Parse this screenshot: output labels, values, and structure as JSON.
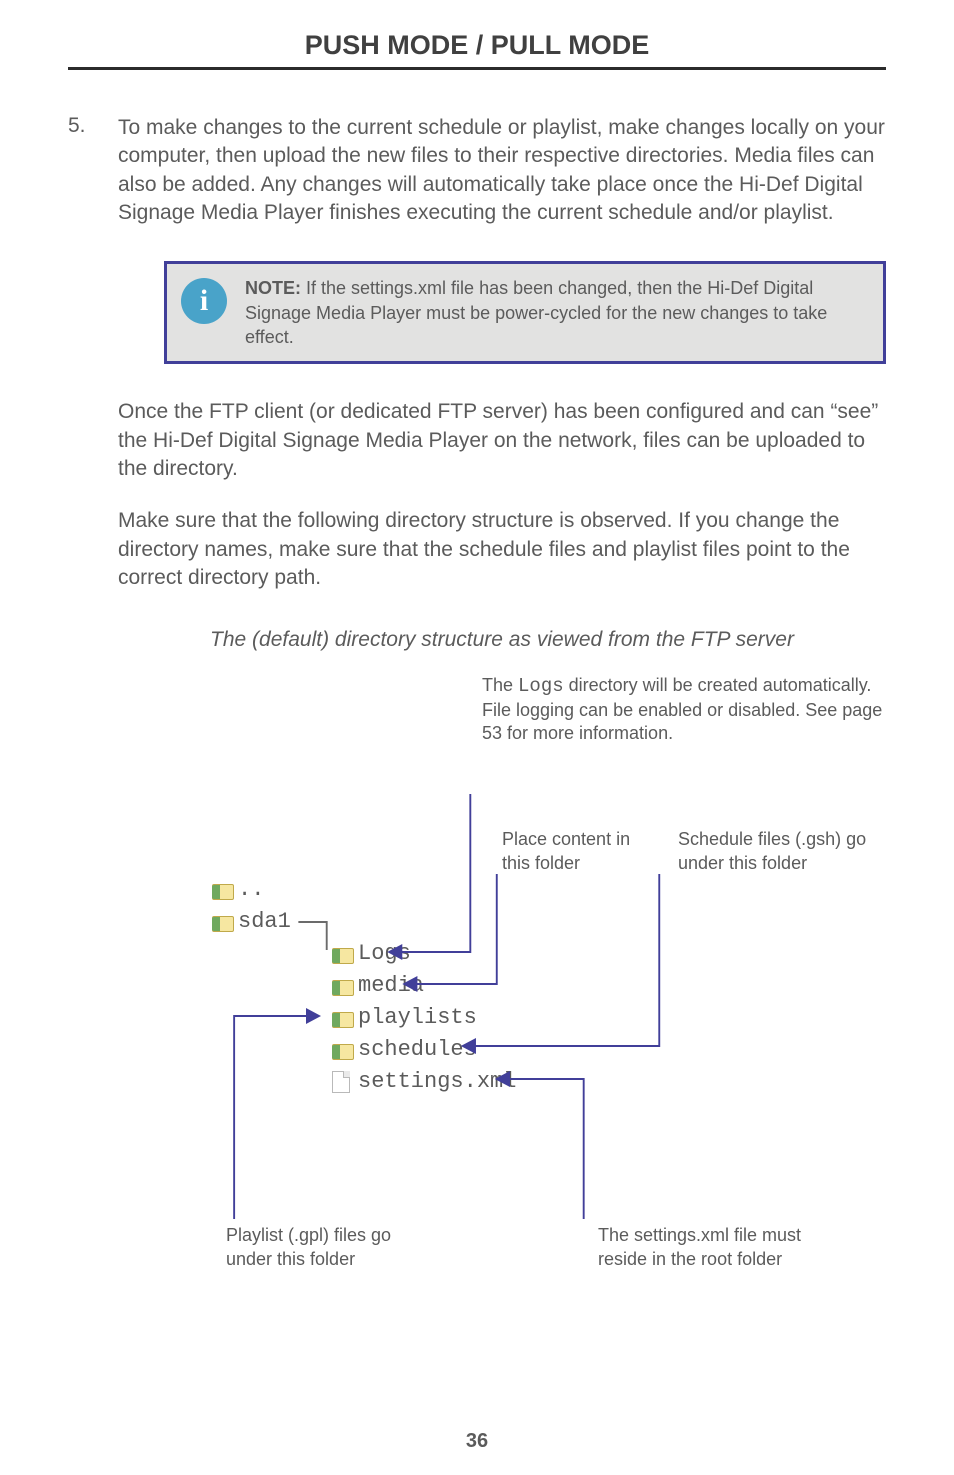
{
  "header": {
    "title": "PUSH MODE / PULL MODE"
  },
  "content": {
    "step_number": "5.",
    "step_text": "To make changes to the current schedule or playlist, make changes locally on your computer, then upload the new files to their respective directories.  Media files can also be added.  Any changes will automatically take place once the Hi-Def Digital Signage Media Player finishes executing the current schedule and/or playlist.",
    "note_label": "NOTE:",
    "note_text": " If the settings.xml file has been changed, then the Hi-Def Digital Signage Media Player must be power-cycled for the new changes to take effect.",
    "para2": "Once the FTP client (or dedicated FTP server) has been configured and can “see” the Hi-Def Digital Signage Media Player on the network, files can be uploaded to the directory.",
    "para3": "Make sure that the following directory structure is observed.  If you change the directory names, make sure that the schedule files and playlist files point to the correct directory path.",
    "caption": "The (default) directory structure as viewed from the FTP server"
  },
  "diagram": {
    "logs_note_pre": "The ",
    "logs_note_code": "Logs",
    "logs_note_post": " directory will be created automatically.\nFile logging can be enabled or disabled. See page 53 for more information.",
    "label_media": "Place content in this folder",
    "label_schedules": "Schedule files (.gsh) go under this folder",
    "label_playlist": "Playlist (.gpl) files go under this folder",
    "label_settings": "The settings.xml file must reside in the root folder",
    "tree": {
      "dotdot": "..",
      "sda1": "sda1",
      "logs": "Logs",
      "media": "media",
      "playlists": "playlists",
      "schedules": "schedules",
      "settings": "settings.xml"
    }
  },
  "page_number": "36"
}
